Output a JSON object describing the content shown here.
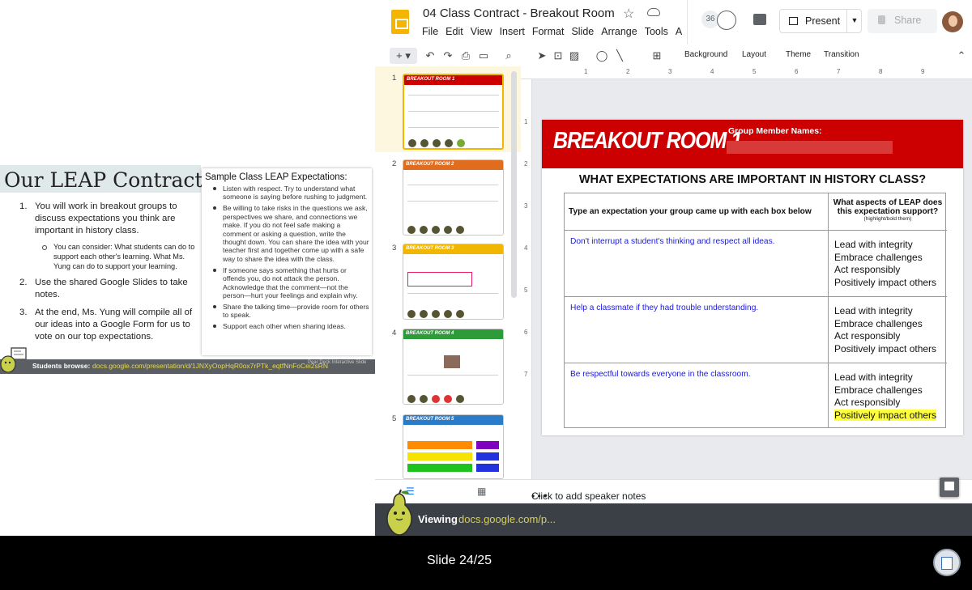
{
  "presenter_slide": {
    "title": "Our LEAP Contract:",
    "items": [
      {
        "num": "1.",
        "text": "You will work in breakout groups to discuss expectations you think are important in history class."
      },
      {
        "num": "2.",
        "text": "Use the shared Google Slides to take notes."
      },
      {
        "num": "3.",
        "text": "At the end, Ms. Yung will compile all of our ideas into a Google Form for us to vote on our top expectations."
      }
    ],
    "sub_item": "You can consider: What students can do to support each other's learning. What Ms. Yung can do to support your learning.",
    "box_title": "Sample Class LEAP Expectations:",
    "box_items": [
      "Listen with respect. Try to understand what someone is saying before rushing to judgment.",
      "Be willing to take risks in the questions we ask, perspectives we share, and connections we make. If you do not feel safe making a comment or asking a question, write the thought down. You can share the idea with your teacher first and together come up with a safe way to share the idea with the class.",
      "If someone says something that hurts or offends you, do not attack the person. Acknowledge that the comment—not the person—hurt your feelings and explain why.",
      "Share the talking time—provide room for others to speak.",
      "Support each other when sharing ideas."
    ],
    "bottom_label": "Students browse:",
    "bottom_url": "docs.google.com/presentation/d/1JNXyOopHqR0ox7rPTk_eqtfNnFoCei2sRN",
    "bottom_tag": "Pear Deck Interactive Slide"
  },
  "slides_app": {
    "doc_title": "04 Class Contract - Breakout Room",
    "menus": [
      "File",
      "Edit",
      "View",
      "Insert",
      "Format",
      "Slide",
      "Arrange",
      "Tools",
      "A"
    ],
    "collab_count": "36",
    "present_label": "Present",
    "share_label": "Share",
    "toolbar_labels": [
      "Background",
      "Layout",
      "Theme",
      "Transition"
    ],
    "ruler_marks": [
      "1",
      "2",
      "3",
      "4",
      "5",
      "6",
      "7",
      "8",
      "9"
    ],
    "vruler_marks": [
      "1",
      "2",
      "3",
      "4",
      "5",
      "6",
      "7"
    ],
    "thumbnails": [
      {
        "num": "1",
        "title": "BREAKOUT ROOM 1",
        "color": "#cc0000"
      },
      {
        "num": "2",
        "title": "BREAKOUT ROOM 2",
        "color": "#e06c1e"
      },
      {
        "num": "3",
        "title": "BREAKOUT ROOM 3",
        "color": "#f1b600"
      },
      {
        "num": "4",
        "title": "BREAKOUT ROOM 4",
        "color": "#2e9b3a"
      },
      {
        "num": "5",
        "title": "BREAKOUT ROOM 5",
        "color": "#2a7bc8"
      }
    ],
    "notes_placeholder": "Click to add speaker notes"
  },
  "main_slide": {
    "room_title": "BREAKOUT ROOM 1",
    "group_label": "Group Member Names:",
    "question": "WHAT EXPECTATIONS ARE IMPORTANT IN HISTORY CLASS?",
    "col1_header": "Type an expectation your group came up with each box below",
    "col2_header": "What aspects of LEAP does this expectation support?",
    "col2_sub": "(highlight/bold them)",
    "rows": [
      {
        "expectation": "Don't interrupt a student's thinking and respect all ideas.",
        "aspects": [
          "Lead with integrity",
          "Embrace challenges",
          "Act responsibly",
          "Positively impact others"
        ],
        "highlight": -1
      },
      {
        "expectation": "Help a classmate if they had trouble understanding.",
        "aspects": [
          "Lead with integrity",
          "Embrace challenges",
          "Act responsibly",
          "Positively impact others"
        ],
        "highlight": -1
      },
      {
        "expectation": "Be respectful towards everyone in the classroom.",
        "aspects": [
          "Lead with integrity",
          "Embrace challenges",
          "Act responsibly",
          "Positively impact others"
        ],
        "highlight": 3
      }
    ]
  },
  "viewing_bar": {
    "label": "Viewing",
    "url": "docs.google.com/p..."
  },
  "footer": {
    "slide_count": "Slide 24/25"
  }
}
